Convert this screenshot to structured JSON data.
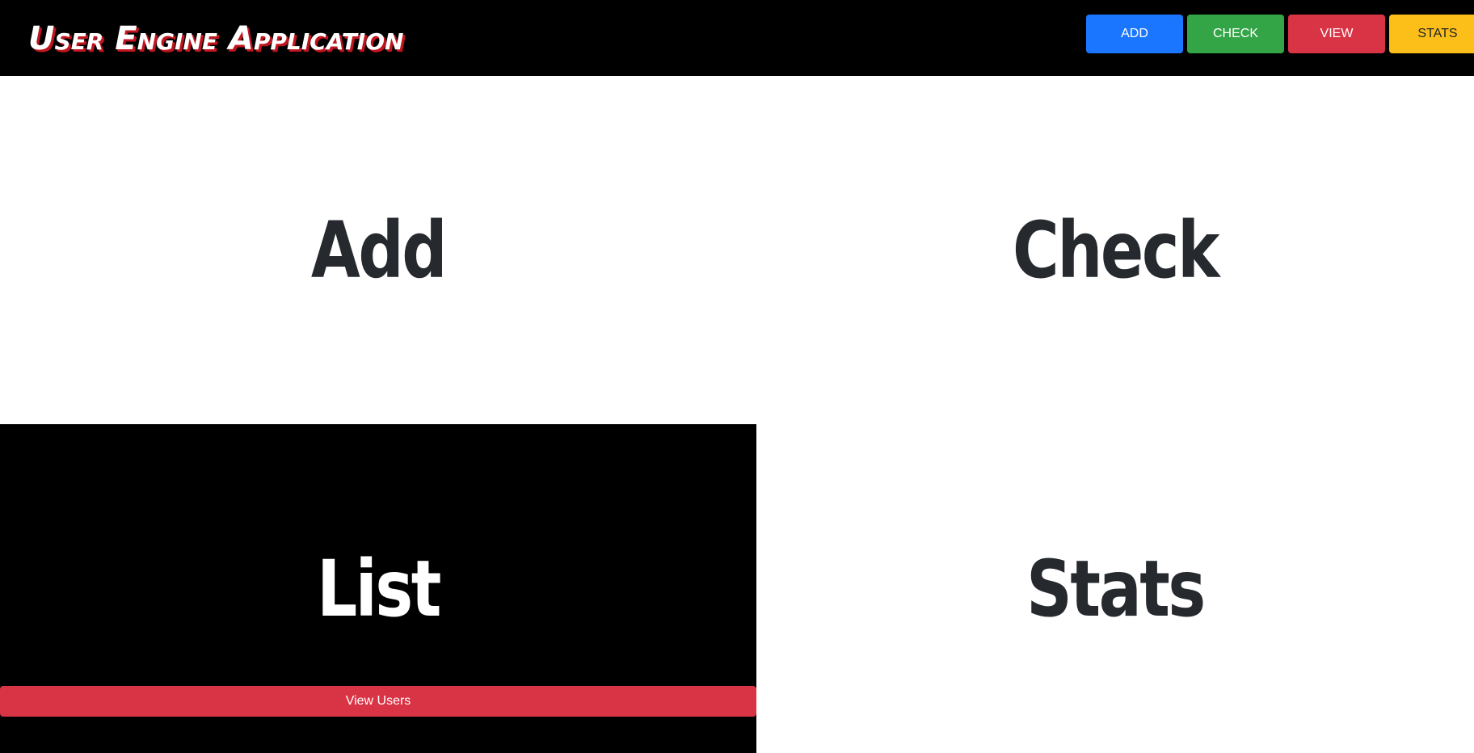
{
  "app": {
    "title": "User Engine Application"
  },
  "nav": {
    "buttons": [
      {
        "label": "ADD",
        "color": "#1a76ff"
      },
      {
        "label": "CHECK",
        "color": "#34a547"
      },
      {
        "label": "VIEW",
        "color": "#d93445"
      },
      {
        "label": "STATS",
        "color": "#fcbf1a"
      }
    ]
  },
  "panels": {
    "add": {
      "title": "Add",
      "text_color": "#26292e"
    },
    "check": {
      "title": "Check",
      "text_color": "#26292e"
    },
    "list": {
      "title": "List",
      "text_color": "#ffffff",
      "button_label": "View Users",
      "button_color": "#d93445"
    },
    "stats": {
      "title": "Stats",
      "text_color": "#26292e"
    }
  }
}
